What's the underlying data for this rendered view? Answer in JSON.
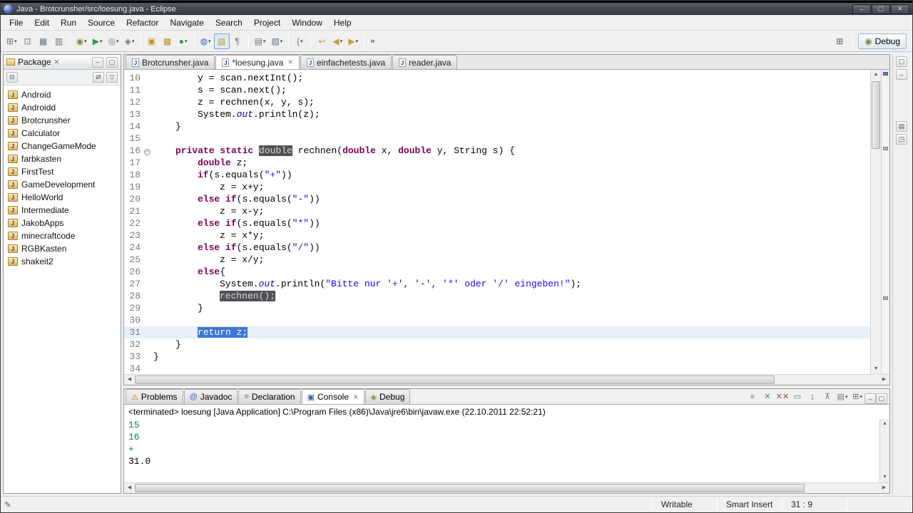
{
  "window": {
    "title": "Java - Brotcrunsher/src/loesung.java - Eclipse",
    "minimize": "–",
    "maximize": "▢",
    "close": "✕"
  },
  "menu": {
    "items": [
      "File",
      "Edit",
      "Run",
      "Source",
      "Refactor",
      "Navigate",
      "Search",
      "Project",
      "Window",
      "Help"
    ]
  },
  "toolbar": {
    "overflow": "»",
    "groups": [
      [
        {
          "name": "new-wizard",
          "g": "⊞",
          "cls": "c-slate",
          "dd": true
        },
        {
          "name": "save",
          "g": "⊡",
          "cls": "c-slate"
        },
        {
          "name": "save-all",
          "g": "▦",
          "cls": "c-slate"
        },
        {
          "name": "print",
          "g": "▥",
          "cls": "c-slate"
        }
      ],
      [
        {
          "name": "debug",
          "g": "◉",
          "cls": "c-olive",
          "dd": true
        },
        {
          "name": "run",
          "g": "▶",
          "cls": "c-green",
          "dd": true
        },
        {
          "name": "coverage",
          "g": "◎",
          "cls": "c-slate",
          "dd": true
        },
        {
          "name": "external-tools",
          "g": "◈",
          "cls": "c-slate",
          "dd": true
        }
      ],
      [
        {
          "name": "new-java-project",
          "g": "▣",
          "cls": "c-amber"
        },
        {
          "name": "new-package",
          "g": "▩",
          "cls": "c-amber"
        },
        {
          "name": "new-class",
          "g": "●",
          "cls": "c-green",
          "dd": true
        }
      ],
      [
        {
          "name": "search",
          "g": "◍",
          "cls": "c-blue",
          "dd": true
        },
        {
          "name": "mark-occurrences",
          "g": "▨",
          "cls": "c-gold",
          "pressed": true
        },
        {
          "name": "show-whitespace",
          "g": "¶",
          "cls": "c-slate"
        }
      ],
      [
        {
          "name": "prev-annotation",
          "g": "▤",
          "cls": "c-slate",
          "dd": true
        },
        {
          "name": "next-annotation",
          "g": "▧",
          "cls": "c-slate",
          "dd": true
        }
      ],
      [
        {
          "name": "code-templates",
          "g": "{",
          "cls": "c-slate",
          "dd": true
        }
      ],
      [
        {
          "name": "last-edit-location",
          "g": "↩",
          "cls": "c-gold"
        },
        {
          "name": "back",
          "g": "◀",
          "cls": "c-gold",
          "dd": true
        },
        {
          "name": "forward",
          "g": "▶",
          "cls": "c-gold",
          "dd": true
        }
      ]
    ]
  },
  "perspective": {
    "open_icon": "⊞",
    "debug_label": "Debug"
  },
  "package_explorer": {
    "title": "Package",
    "items": [
      "Android",
      "Androidd",
      "Brotcrunsher",
      "Calculator",
      "ChangeGameMode",
      "farbkasten",
      "FirstTest",
      "GameDevelopment",
      "HelloWorld",
      "Intermediate",
      "JakobApps",
      "minecraftcode",
      "RGBKasten",
      "shakeit2"
    ]
  },
  "editor": {
    "tabs": [
      {
        "label": "Brotcrunsher.java",
        "active": false
      },
      {
        "label": "*loesung.java",
        "active": true,
        "dirty": true
      },
      {
        "label": "einfachetests.java",
        "active": false
      },
      {
        "label": "reader.java",
        "active": false
      }
    ],
    "lines": [
      {
        "n": 10,
        "i": 2,
        "t": [
          [
            "p",
            "y = scan.nextInt();"
          ]
        ]
      },
      {
        "n": 11,
        "i": 2,
        "t": [
          [
            "p",
            "s = scan.next();"
          ]
        ]
      },
      {
        "n": 12,
        "i": 2,
        "t": [
          [
            "p",
            "z = rechnen(x, y, s);"
          ]
        ]
      },
      {
        "n": 13,
        "i": 2,
        "t": [
          [
            "p",
            "System."
          ],
          [
            "f",
            "out"
          ],
          [
            "p",
            ".println(z);"
          ]
        ]
      },
      {
        "n": 14,
        "i": 1,
        "t": [
          [
            "p",
            "}"
          ]
        ]
      },
      {
        "n": 15,
        "i": 0,
        "t": []
      },
      {
        "n": 16,
        "i": 1,
        "fold": true,
        "t": [
          [
            "k",
            "private"
          ],
          [
            "p",
            " "
          ],
          [
            "k",
            "static"
          ],
          [
            "p",
            " "
          ],
          [
            "occ",
            "double"
          ],
          [
            "p",
            " rechnen("
          ],
          [
            "k",
            "double"
          ],
          [
            "p",
            " x, "
          ],
          [
            "k",
            "double"
          ],
          [
            "p",
            " y, String s) {"
          ]
        ]
      },
      {
        "n": 17,
        "i": 2,
        "t": [
          [
            "k",
            "double"
          ],
          [
            "p",
            " z;"
          ]
        ]
      },
      {
        "n": 18,
        "i": 2,
        "t": [
          [
            "k",
            "if"
          ],
          [
            "p",
            "(s.equals("
          ],
          [
            "s",
            "\"+\""
          ],
          [
            "p",
            "))"
          ]
        ]
      },
      {
        "n": 19,
        "i": 3,
        "t": [
          [
            "p",
            "z = x+y;"
          ]
        ]
      },
      {
        "n": 20,
        "i": 2,
        "t": [
          [
            "k",
            "else"
          ],
          [
            "p",
            " "
          ],
          [
            "k",
            "if"
          ],
          [
            "p",
            "(s.equals("
          ],
          [
            "s",
            "\"-\""
          ],
          [
            "p",
            "))"
          ]
        ]
      },
      {
        "n": 21,
        "i": 3,
        "t": [
          [
            "p",
            "z = x-y;"
          ]
        ]
      },
      {
        "n": 22,
        "i": 2,
        "t": [
          [
            "k",
            "else"
          ],
          [
            "p",
            " "
          ],
          [
            "k",
            "if"
          ],
          [
            "p",
            "(s.equals("
          ],
          [
            "s",
            "\"*\""
          ],
          [
            "p",
            "))"
          ]
        ]
      },
      {
        "n": 23,
        "i": 3,
        "t": [
          [
            "p",
            "z = x*y;"
          ]
        ]
      },
      {
        "n": 24,
        "i": 2,
        "t": [
          [
            "k",
            "else"
          ],
          [
            "p",
            " "
          ],
          [
            "k",
            "if"
          ],
          [
            "p",
            "(s.equals("
          ],
          [
            "s",
            "\"/\""
          ],
          [
            "p",
            "))"
          ]
        ]
      },
      {
        "n": 25,
        "i": 3,
        "t": [
          [
            "p",
            "z = x/y;"
          ]
        ]
      },
      {
        "n": 26,
        "i": 2,
        "t": [
          [
            "k",
            "else"
          ],
          [
            "p",
            "{"
          ]
        ]
      },
      {
        "n": 27,
        "i": 3,
        "t": [
          [
            "p",
            "System."
          ],
          [
            "f",
            "out"
          ],
          [
            "p",
            ".println("
          ],
          [
            "s",
            "\"Bitte nur '+', '-', '*' oder '/' eingeben!\""
          ],
          [
            "p",
            ");"
          ]
        ]
      },
      {
        "n": 28,
        "i": 3,
        "t": [
          [
            "occ",
            "rechnen();"
          ]
        ]
      },
      {
        "n": 29,
        "i": 2,
        "t": [
          [
            "p",
            "}"
          ]
        ]
      },
      {
        "n": 30,
        "i": 0,
        "t": []
      },
      {
        "n": 31,
        "i": 2,
        "current": true,
        "caret": true,
        "t": [
          [
            "sel",
            "return z;"
          ]
        ]
      },
      {
        "n": 32,
        "i": 1,
        "t": [
          [
            "p",
            "}"
          ]
        ]
      },
      {
        "n": 33,
        "i": 0,
        "t": [
          [
            "p",
            "}"
          ]
        ]
      },
      {
        "n": 34,
        "i": 0,
        "t": []
      }
    ]
  },
  "bottom": {
    "tabs": [
      {
        "label": "Problems",
        "icon": "⚠",
        "cls": "c-warn"
      },
      {
        "label": "Javadoc",
        "icon": "@",
        "cls": "c-blue"
      },
      {
        "label": "Declaration",
        "icon": "≡",
        "cls": "c-slate"
      },
      {
        "label": "Console",
        "icon": "▣",
        "cls": "c-blue",
        "active": true
      },
      {
        "label": "Debug",
        "icon": "◈",
        "cls": "c-olive"
      }
    ]
  },
  "console_toolbar": {
    "buttons": [
      {
        "name": "terminate",
        "g": "■",
        "disabled": true
      },
      {
        "name": "remove-launch",
        "g": "✕",
        "cls": "c-slate"
      },
      {
        "name": "remove-all-launches",
        "g": "✕✕",
        "cls": "c-red"
      },
      {
        "name": "clear-console",
        "g": "▭",
        "cls": "c-slate"
      },
      {
        "name": "scroll-lock",
        "g": "↨",
        "cls": "c-slate"
      },
      {
        "name": "pin-console",
        "g": "⊼",
        "cls": "c-slate"
      },
      {
        "name": "display-selected-console",
        "g": "▤",
        "cls": "c-slate",
        "dd": true
      },
      {
        "name": "open-console",
        "g": "⊞",
        "cls": "c-slate",
        "dd": true
      }
    ]
  },
  "console": {
    "header": "<terminated> loesung [Java Application] C:\\Program Files (x86)\\Java\\jre6\\bin\\javaw.exe (22.10.2011 22:52:21)",
    "lines": [
      {
        "text": "15",
        "stream": "stdin"
      },
      {
        "text": "16",
        "stream": "stdin"
      },
      {
        "text": "+",
        "stream": "stdin"
      },
      {
        "text": "31.0",
        "stream": "stdout"
      }
    ]
  },
  "status": {
    "cells": [
      "Writable",
      "Smart Insert",
      "31 : 9"
    ]
  },
  "colors": {
    "keyword": "#7f0055",
    "string": "#2a00ff",
    "field": "#0000c0",
    "selection": "#3c77d8",
    "current_line": "#e7f0fb",
    "occurrence_bg": "#515155",
    "stdin_green": "#00855f"
  }
}
